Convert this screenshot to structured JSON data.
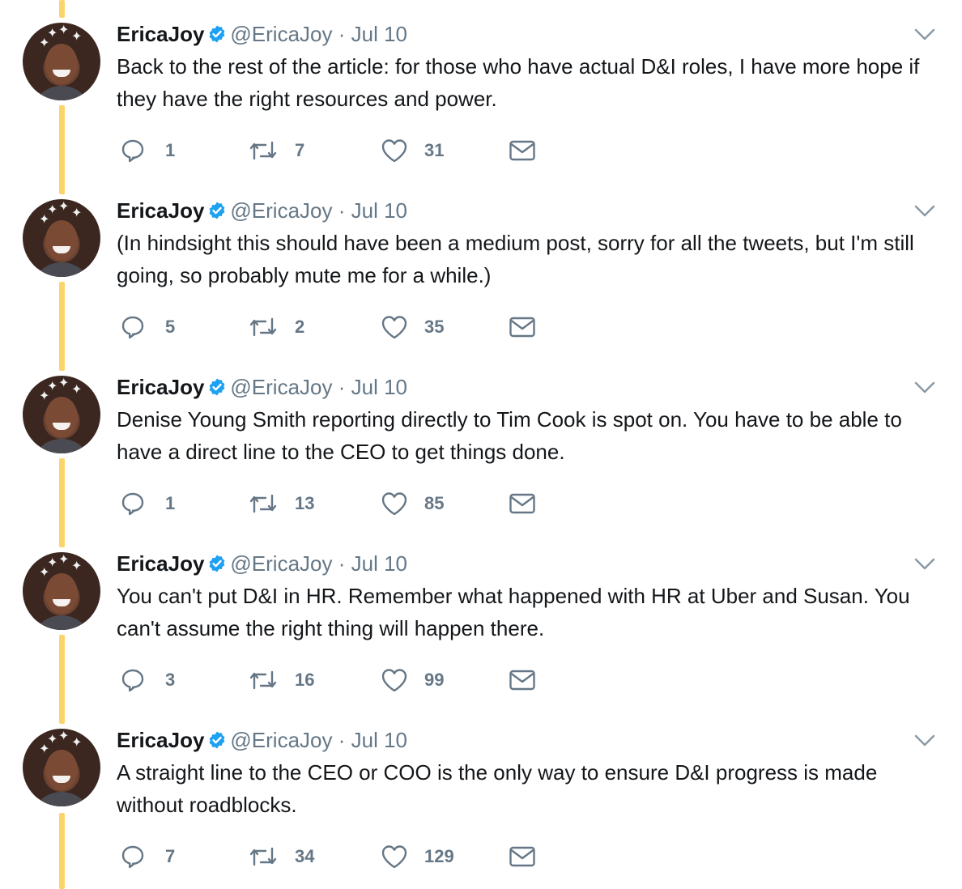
{
  "colors": {
    "thread_line": "#fbd46d",
    "verified": "#1da1f2",
    "secondary_text": "#657786",
    "primary_text": "#14171a"
  },
  "tweets": [
    {
      "name": "EricaJoy",
      "handle": "@EricaJoy",
      "separator": "·",
      "date": "Jul 10",
      "text": "Back to the rest of the article: for those who have actual D&I roles, I have more hope if they have the right resources and power.",
      "replies": "1",
      "retweets": "7",
      "likes": "31"
    },
    {
      "name": "EricaJoy",
      "handle": "@EricaJoy",
      "separator": "·",
      "date": "Jul 10",
      "text": "(In hindsight this should have been a medium post, sorry for all the tweets, but I'm still going, so probably mute me for a while.)",
      "replies": "5",
      "retweets": "2",
      "likes": "35"
    },
    {
      "name": "EricaJoy",
      "handle": "@EricaJoy",
      "separator": "·",
      "date": "Jul 10",
      "text": "Denise Young Smith reporting directly to Tim Cook is spot on. You have to be able to have a direct line to the CEO to get things done.",
      "replies": "1",
      "retweets": "13",
      "likes": "85"
    },
    {
      "name": "EricaJoy",
      "handle": "@EricaJoy",
      "separator": "·",
      "date": "Jul 10",
      "text": "You can't put D&I in HR. Remember what happened with HR at Uber and Susan. You can't assume the right thing will happen there.",
      "replies": "3",
      "retweets": "16",
      "likes": "99"
    },
    {
      "name": "EricaJoy",
      "handle": "@EricaJoy",
      "separator": "·",
      "date": "Jul 10",
      "text": "A straight line to the CEO or COO is the only way to ensure D&I progress is made without roadblocks.",
      "replies": "7",
      "retweets": "34",
      "likes": "129"
    }
  ],
  "icons": {
    "reply": "reply-icon",
    "retweet": "retweet-icon",
    "like": "heart-icon",
    "dm": "envelope-icon",
    "verified": "verified-badge-icon",
    "caret": "chevron-down-icon"
  }
}
